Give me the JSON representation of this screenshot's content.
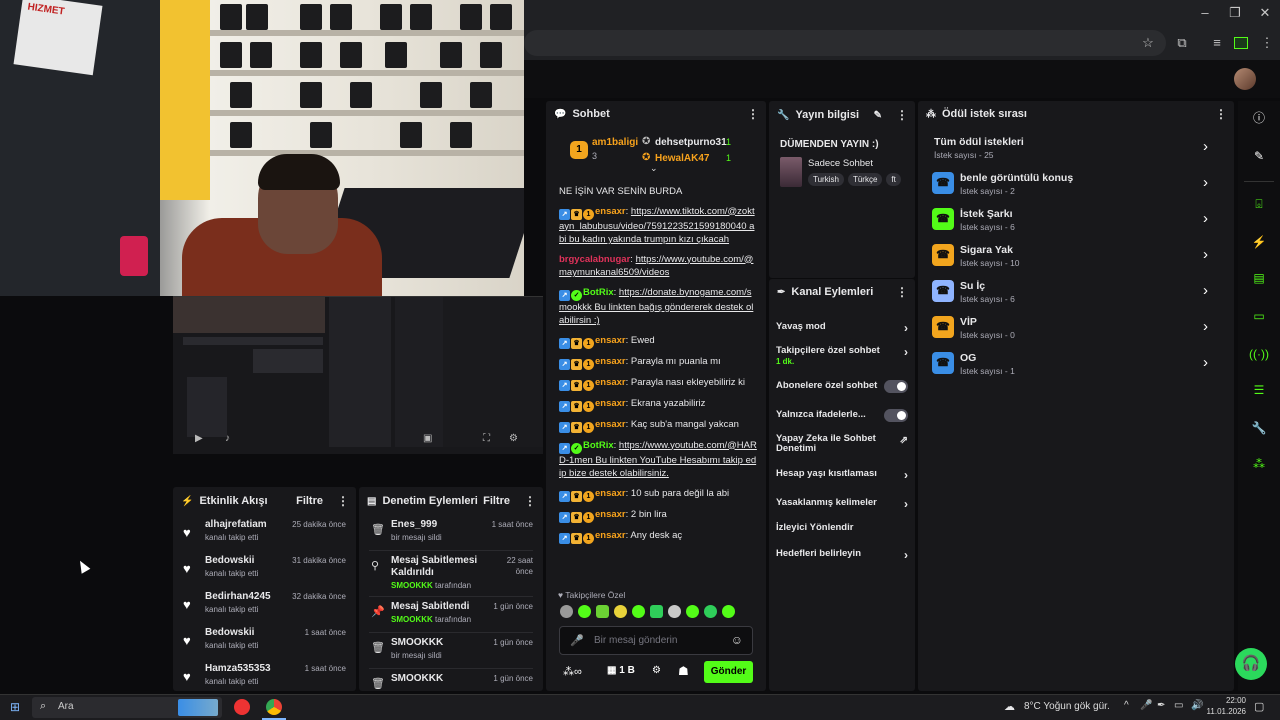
{
  "webcam_watermark": "HIZMET",
  "activity": {
    "title": "Etkinlik Akışı",
    "filter": "Filtre",
    "items": [
      {
        "name": "alhajrefatiam",
        "action": "kanalı takip etti",
        "time": "25 dakika önce"
      },
      {
        "name": "Bedowskii",
        "action": "kanalı takip etti",
        "time": "31 dakika önce"
      },
      {
        "name": "Bedirhan4245",
        "action": "kanalı takip etti",
        "time": "32 dakika önce"
      },
      {
        "name": "Bedowskii",
        "action": "kanalı takip etti",
        "time": "1 saat önce"
      },
      {
        "name": "Hamza535353",
        "action": "kanalı takip etti",
        "time": "1 saat önce"
      }
    ]
  },
  "moderation": {
    "title": "Denetim Eylemleri",
    "filter": "Filtre",
    "items": [
      {
        "title": "Enes_999",
        "sub": "bir mesajı sildi",
        "time": "1 saat önce"
      },
      {
        "title": "Mesaj Sabitlemesi Kaldırıldı",
        "by": "SMOOKKK",
        "by_suffix": "tarafından",
        "time": "22 saat önce"
      },
      {
        "title": "Mesaj Sabitlendi",
        "by": "SMOOKKK",
        "by_suffix": "tarafından",
        "time": "1 gün önce"
      },
      {
        "title": "SMOOKKK",
        "sub": "bir mesajı sildi",
        "time": "1 gün önce"
      },
      {
        "title": "SMOOKKK",
        "sub": "",
        "time": "1 gün önce"
      }
    ]
  },
  "chat": {
    "title": "Sohbet",
    "top_gifters": [
      {
        "name": "am1baligi",
        "rank": "1",
        "count": "3"
      },
      {
        "name": "dehsetpurno31",
        "count": "1"
      },
      {
        "name": "HewalAK47",
        "count": "1"
      }
    ],
    "messages": [
      {
        "user": "",
        "text": "NE İŞİN VAR SENİN BURDA"
      },
      {
        "user": "ensaxr",
        "text": "https://www.tiktok.com/@zoktayn_labubusu/video/7591223521599180040 abi bu kadın yakında trumpın kızı çıkacah"
      },
      {
        "user": "brgycalabnugar",
        "text": "https://www.youtube.com/@maymunkanal6509/videos"
      },
      {
        "user": "BotRix",
        "text": "https://donate.bynogame.com/smookkk Bu linkten bağış göndererek destek olabilirsin :)"
      },
      {
        "user": "ensaxr",
        "text": "Ewed"
      },
      {
        "user": "ensaxr",
        "text": "Parayla mı puanla mı"
      },
      {
        "user": "ensaxr",
        "text": "Parayla nası ekleyebiliriz ki"
      },
      {
        "user": "ensaxr",
        "text": "Ekrana yazabiliriz"
      },
      {
        "user": "ensaxr",
        "text": "Kaç sub'a mangal yakcan"
      },
      {
        "user": "BotRix",
        "text": "https://www.youtube.com/@HARD-1men Bu linkten YouTube Hesabımı takip edip bize destek olabilirsiniz."
      },
      {
        "user": "ensaxr",
        "text": "10 sub para değil la abi"
      },
      {
        "user": "ensaxr",
        "text": "2 bin lira"
      },
      {
        "user": "ensaxr",
        "text": "Any desk aç"
      }
    ],
    "followers_only_label": "Takipçilere Özel",
    "input_placeholder": "Bir mesaj gönderin",
    "points": "1 B",
    "send": "Gönder"
  },
  "stream_info": {
    "title": "Yayın bilgisi",
    "stream_title": "DÜMENDEN YAYIN :)",
    "category": "Sadece Sohbet",
    "tags": [
      "Turkish",
      "Türkçe",
      "ft"
    ]
  },
  "channel_actions": {
    "title": "Kanal Eylemleri",
    "items": {
      "slow": "Yavaş mod",
      "followers": "Takipçilere özel sohbet",
      "followers_sub": "1 dk.",
      "subs": "Abonelere özel sohbet",
      "emotes": "Yalnızca ifadelerle...",
      "ai": "Yapay Zeka ile Sohbet Denetimi",
      "age": "Hesap yaşı kısıtlaması",
      "banned": "Yasaklanmış kelimeler",
      "redirect": "İzleyici Yönlendir",
      "goals": "Hedefleri belirleyin"
    }
  },
  "rewards": {
    "title": "Ödül istek sırası",
    "all": {
      "title": "Tüm ödül istekleri",
      "sub": "İstek sayısı - 25"
    },
    "items": [
      {
        "title": "benle görüntülü konuş",
        "sub": "İstek sayısı - 2",
        "color": "#3a8ee6"
      },
      {
        "title": "İstek Şarkı",
        "sub": "İstek sayısı - 6",
        "color": "#53fc18"
      },
      {
        "title": "Sigara Yak",
        "sub": "İstek sayısı - 10",
        "color": "#f2a51e"
      },
      {
        "title": "Su İç",
        "sub": "İstek sayısı - 6",
        "color": "#8fb4ff"
      },
      {
        "title": "VİP",
        "sub": "İstek sayısı - 0",
        "color": "#f2a51e"
      },
      {
        "title": "OG",
        "sub": "İstek sayısı - 1",
        "color": "#3a8ee6"
      }
    ]
  },
  "taskbar": {
    "search": "Ara",
    "weather": "8°C  Yoğun gök gür.",
    "time": "22:00",
    "date": "11.01.2026"
  }
}
